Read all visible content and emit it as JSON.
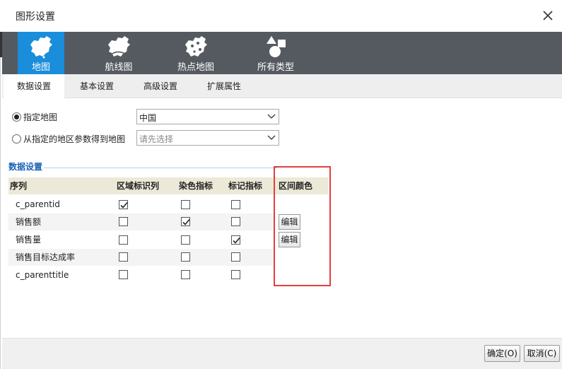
{
  "window": {
    "title": "图形设置",
    "close_icon": "close-icon"
  },
  "chart_types": [
    {
      "label": "地图",
      "icon": "china-map-icon",
      "active": true
    },
    {
      "label": "航线图",
      "icon": "flight-map-icon",
      "active": false
    },
    {
      "label": "热点地图",
      "icon": "heat-map-icon",
      "active": false
    },
    {
      "label": "所有类型",
      "icon": "all-types-icon",
      "active": false
    }
  ],
  "tabs": [
    {
      "label": "数据设置",
      "active": true
    },
    {
      "label": "基本设置",
      "active": false
    },
    {
      "label": "高级设置",
      "active": false
    },
    {
      "label": "扩展属性",
      "active": false
    }
  ],
  "map_source": {
    "option_specified": {
      "label": "指定地图",
      "selected": true
    },
    "option_from_param": {
      "label": "从指定的地区参数得到地图",
      "selected": false
    },
    "map_select": {
      "value": "中国"
    },
    "param_select": {
      "placeholder": "请先选择"
    }
  },
  "data_section": {
    "title": "数据设置",
    "columns": [
      "序列",
      "区域标识列",
      "染色指标",
      "标记指标",
      "区间颜色"
    ],
    "rows": [
      {
        "name": "c_parentid",
        "region_id": true,
        "color_index": false,
        "mark_index": false,
        "has_edit": false
      },
      {
        "name": "销售额",
        "region_id": false,
        "color_index": true,
        "mark_index": false,
        "has_edit": true
      },
      {
        "name": "销售量",
        "region_id": false,
        "color_index": false,
        "mark_index": true,
        "has_edit": true
      },
      {
        "name": "销售目标达成率",
        "region_id": false,
        "color_index": false,
        "mark_index": false,
        "has_edit": false
      },
      {
        "name": "c_parenttitle",
        "region_id": false,
        "color_index": false,
        "mark_index": false,
        "has_edit": false
      }
    ],
    "edit_label": "编辑"
  },
  "footer": {
    "ok_label": "确定(O)",
    "cancel_label": "取消(C)"
  },
  "colors": {
    "accent": "#1a8ddb",
    "typebar": "#555a60",
    "section_title": "#1a63b8",
    "highlight": "#e04040",
    "header_bg": "#ece9d8"
  }
}
